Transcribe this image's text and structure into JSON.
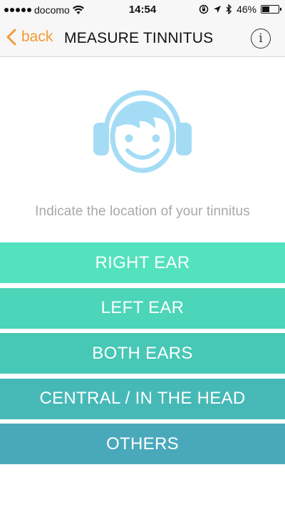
{
  "status_bar": {
    "carrier": "docomo",
    "time": "14:54",
    "battery_percent": "46%",
    "battery_level": 0.46
  },
  "nav": {
    "back_label": "back",
    "title": "MEASURE TINNITUS",
    "info_label": "i"
  },
  "prompt": "Indicate the location of your tinnitus",
  "options": [
    {
      "label": "RIGHT EAR",
      "color": "#52e2bd"
    },
    {
      "label": "LEFT EAR",
      "color": "#4cd5b8"
    },
    {
      "label": "BOTH EARS",
      "color": "#47c7b5"
    },
    {
      "label": "CENTRAL / IN THE HEAD",
      "color": "#46b9b7"
    },
    {
      "label": "OTHERS",
      "color": "#49a9bb"
    }
  ],
  "colors": {
    "accent": "#f39a34",
    "icon": "#a5dcf5",
    "prompt_text": "#a8a8a8"
  }
}
